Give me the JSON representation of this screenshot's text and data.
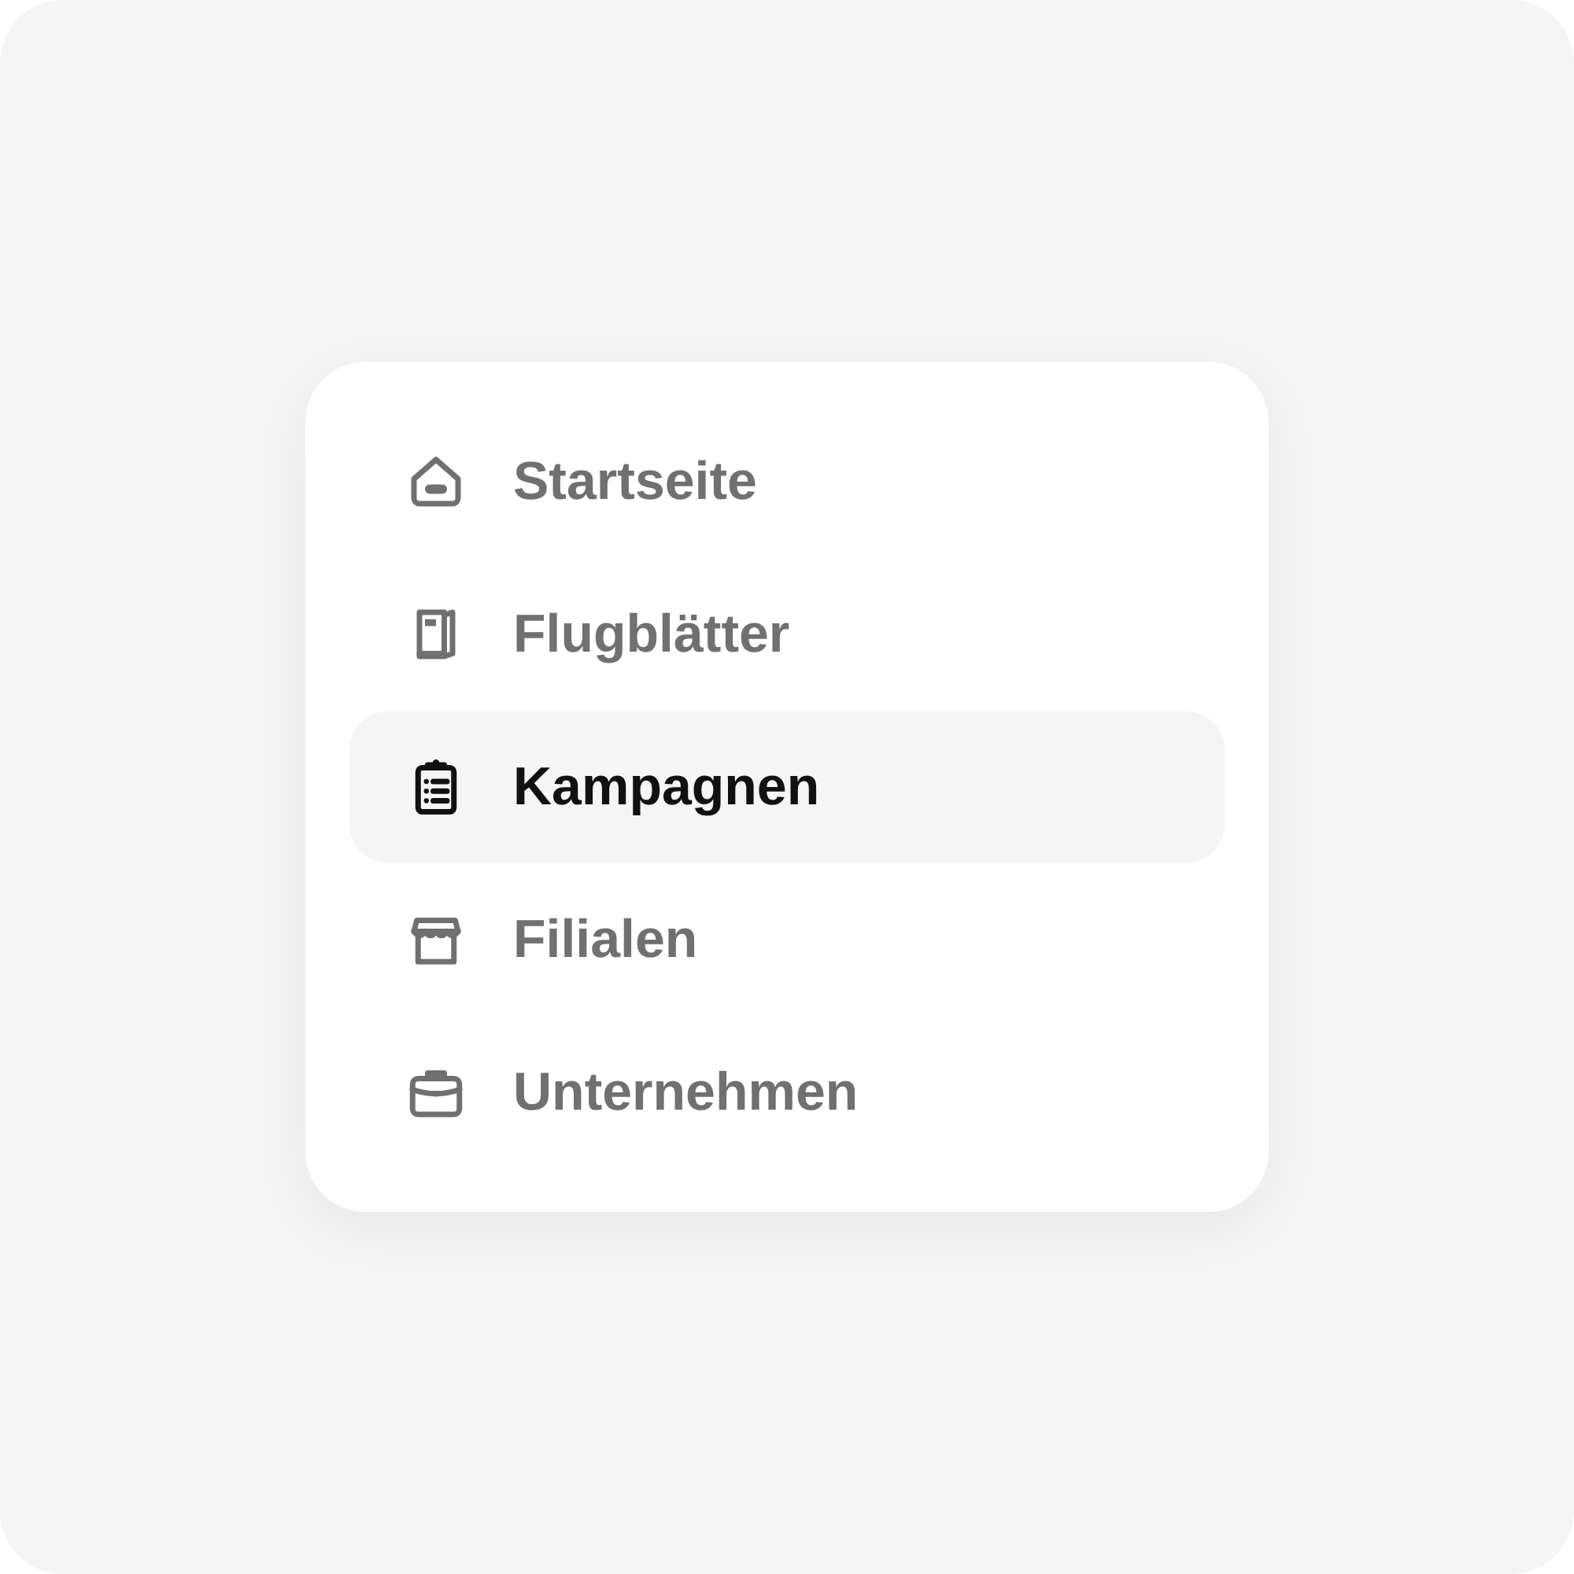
{
  "menu": {
    "items": [
      {
        "label": "Startseite",
        "kind": "home",
        "selected": false
      },
      {
        "label": "Flugblätter",
        "kind": "flyer",
        "selected": false
      },
      {
        "label": "Kampagnen",
        "kind": "clipboard",
        "selected": true
      },
      {
        "label": "Filialen",
        "kind": "store",
        "selected": false
      },
      {
        "label": "Unternehmen",
        "kind": "briefcase",
        "selected": false
      }
    ]
  }
}
